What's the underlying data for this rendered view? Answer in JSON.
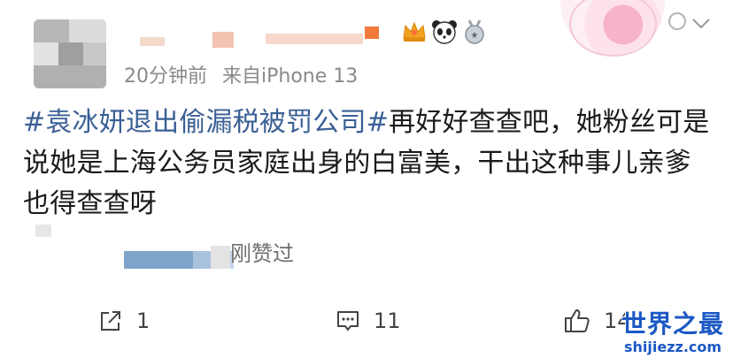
{
  "post": {
    "timestamp": "20分钟前",
    "source": "来自iPhone 13",
    "content": {
      "topic": "#袁冰妍退出偷漏税被罚公司#",
      "text": "再好好查查吧，她粉丝可是说她是上海公务员家庭出身的白富美，干出这种事儿亲爹也得查查呀"
    },
    "liked_label": "刚赞过"
  },
  "badges": [
    {
      "icon": "crown-icon"
    },
    {
      "icon": "panda-icon"
    },
    {
      "icon": "medal-icon"
    }
  ],
  "actions": {
    "repost_count": "1",
    "comment_count": "11",
    "like_count": "14"
  },
  "watermark": {
    "title": "世界之最",
    "url": "shijiezz.com"
  },
  "colors": {
    "topic": "#3a5f95",
    "meta_text": "#8a8a8a",
    "watermark": "#1b58c4"
  }
}
